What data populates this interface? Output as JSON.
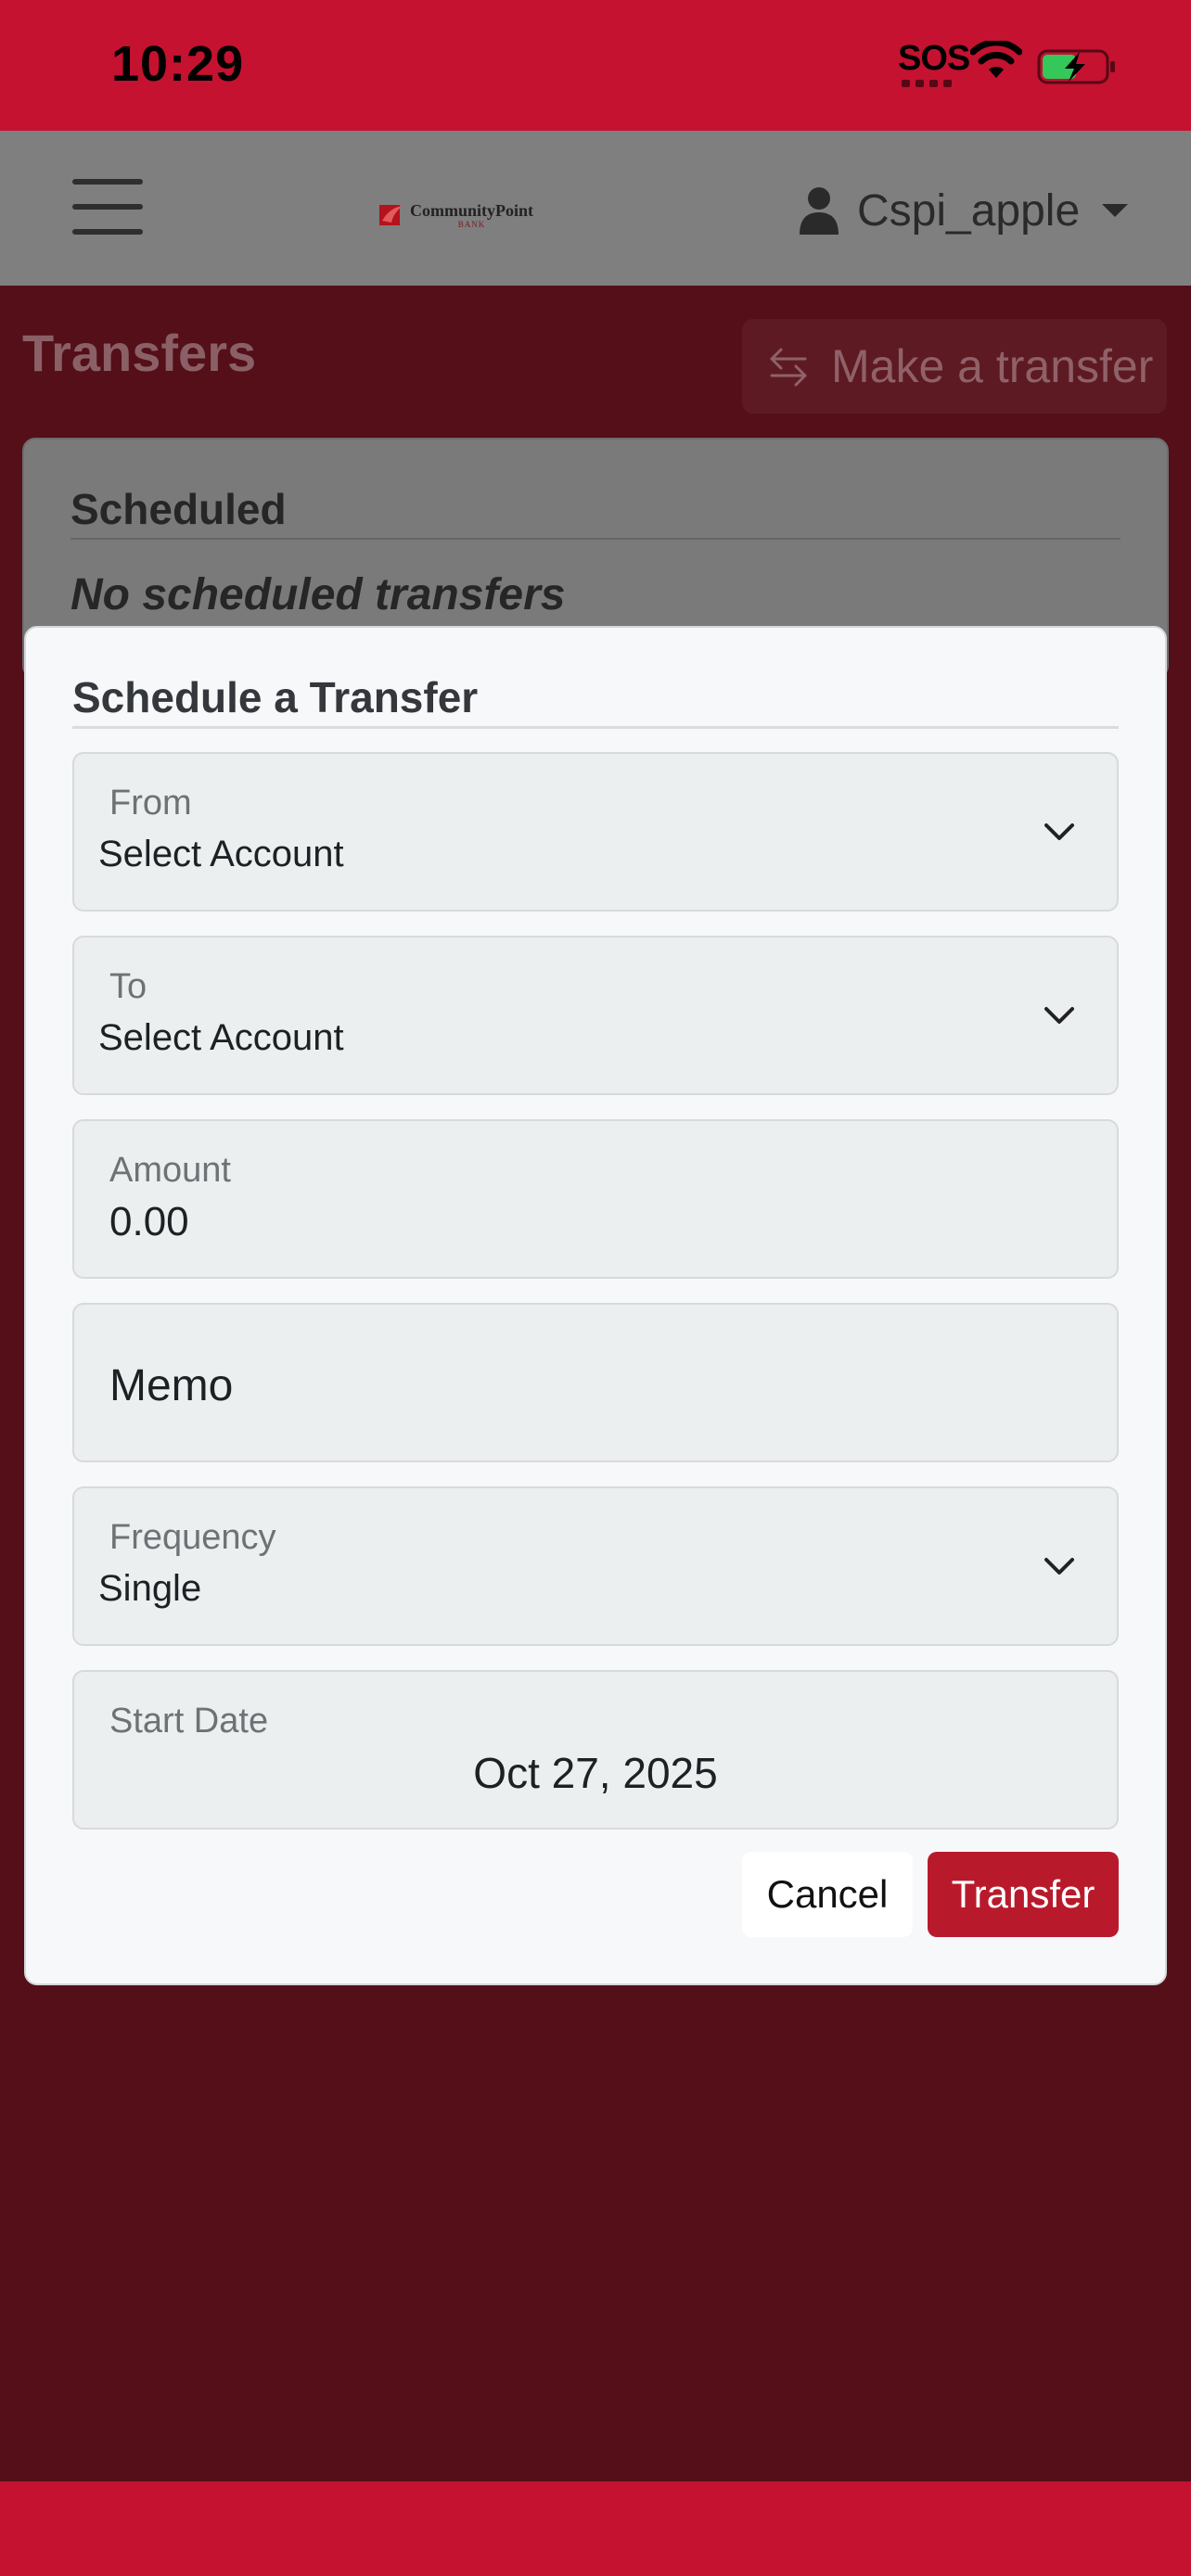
{
  "status_bar": {
    "time": "10:29",
    "sos": "SOS",
    "icons": [
      "wifi-icon",
      "battery-charging-icon"
    ]
  },
  "navbar": {
    "menu_icon": "hamburger-menu-icon",
    "logo": {
      "name": "CommunityPoint",
      "sub": "BANK"
    },
    "user": {
      "icon": "user-icon",
      "username": "Cspi_apple",
      "caret": "caret-down-icon"
    }
  },
  "page": {
    "title": "Transfers",
    "make_transfer_label": "Make a transfer",
    "make_transfer_icon": "swap-arrows-icon"
  },
  "scheduled": {
    "title": "Scheduled",
    "empty_message": "No scheduled transfers"
  },
  "modal": {
    "title": "Schedule a Transfer",
    "from": {
      "label": "From",
      "value": "Select Account"
    },
    "to": {
      "label": "To",
      "value": "Select Account"
    },
    "amount": {
      "label": "Amount",
      "value": "0.00"
    },
    "memo": {
      "placeholder": "Memo"
    },
    "frequency": {
      "label": "Frequency",
      "value": "Single"
    },
    "start_date": {
      "label": "Start Date",
      "value": "Oct 27, 2025"
    },
    "cancel_label": "Cancel",
    "transfer_label": "Transfer"
  },
  "colors": {
    "brand_red": "#c41230",
    "transfer_button": "#b81a2c",
    "backdrop": "#540f19"
  }
}
